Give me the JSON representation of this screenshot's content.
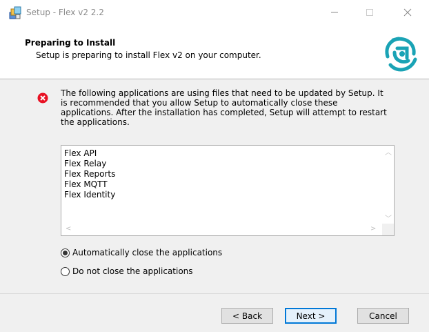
{
  "window": {
    "title": "Setup - Flex v2 2.2",
    "controls": {
      "minimize": "—",
      "maximize": "☐",
      "close": "✕"
    }
  },
  "header": {
    "title": "Preparing to Install",
    "subtitle": "Setup is preparing to install Flex v2 on your computer.",
    "logo_icon": "flex-logo-icon",
    "logo_color": "#1aa3b5"
  },
  "message": {
    "icon": "error-icon",
    "icon_color": "#e81123",
    "text": "The following applications are using files that need to be updated by Setup. It is recommended that you allow Setup to automatically close these applications. After the installation has completed, Setup will attempt to restart the applications."
  },
  "applications": [
    "Flex API",
    "Flex Relay",
    "Flex Reports",
    "Flex MQTT",
    "Flex Identity"
  ],
  "options": {
    "auto_close": {
      "label": "Automatically close the applications",
      "checked": true
    },
    "no_close": {
      "label": "Do not close the applications",
      "checked": false
    }
  },
  "buttons": {
    "back": "< Back",
    "next": "Next >",
    "cancel": "Cancel"
  }
}
